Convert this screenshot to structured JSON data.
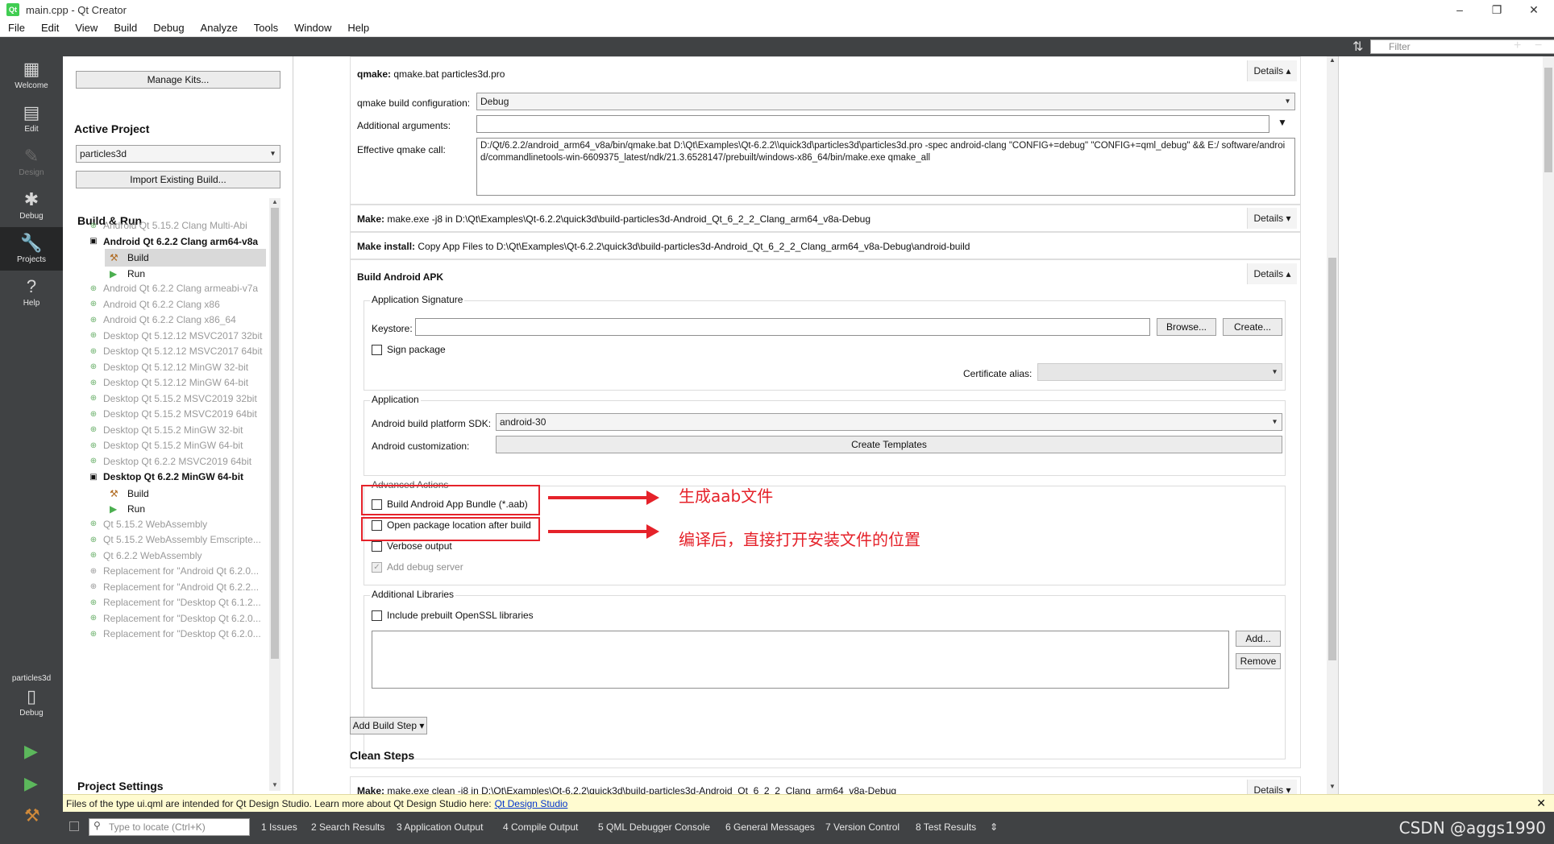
{
  "window": {
    "title": "main.cpp - Qt Creator",
    "logo_text": "Qt",
    "minimize": "–",
    "maximize": "❐",
    "close": "✕"
  },
  "menu": [
    "File",
    "Edit",
    "View",
    "Build",
    "Debug",
    "Analyze",
    "Tools",
    "Window",
    "Help"
  ],
  "modes": [
    {
      "label": "Welcome"
    },
    {
      "label": "Edit"
    },
    {
      "label": "Design"
    },
    {
      "label": "Debug"
    },
    {
      "label": "Projects"
    },
    {
      "label": "Help"
    }
  ],
  "kit_selector": {
    "project": "particles3d",
    "mode": "Debug"
  },
  "filter": {
    "placeholder": "Filter"
  },
  "left": {
    "manage_kits": "Manage Kits...",
    "active_project_heading": "Active Project",
    "active_project_value": "particles3d",
    "import_build": "Import Existing Build...",
    "build_run_heading": "Build & Run",
    "project_settings_heading": "Project Settings",
    "kits": [
      {
        "label": "Android Qt 5.15.2 Clang Multi-Abi",
        "style": "dim"
      },
      {
        "label": "Android Qt 6.2.2 Clang arm64-v8a",
        "style": "active"
      },
      {
        "label": "Android Qt 6.2.2 Clang armeabi-v7a",
        "style": "dim"
      },
      {
        "label": "Android Qt 6.2.2 Clang x86",
        "style": "dim"
      },
      {
        "label": "Android Qt 6.2.2 Clang x86_64",
        "style": "dim"
      },
      {
        "label": "Desktop Qt 5.12.12 MSVC2017 32bit",
        "style": "dim"
      },
      {
        "label": "Desktop Qt 5.12.12 MSVC2017 64bit",
        "style": "dim"
      },
      {
        "label": "Desktop Qt 5.12.12 MinGW 32-bit",
        "style": "dim"
      },
      {
        "label": "Desktop Qt 5.12.12 MinGW 64-bit",
        "style": "dim"
      },
      {
        "label": "Desktop Qt 5.15.2 MSVC2019 32bit",
        "style": "dim"
      },
      {
        "label": "Desktop Qt 5.15.2 MSVC2019 64bit",
        "style": "dim"
      },
      {
        "label": "Desktop Qt 5.15.2 MinGW 32-bit",
        "style": "dim"
      },
      {
        "label": "Desktop Qt 5.15.2 MinGW 64-bit",
        "style": "dim"
      },
      {
        "label": "Desktop Qt 6.2.2 MSVC2019 64bit",
        "style": "dim"
      },
      {
        "label": "Desktop Qt 6.2.2 MinGW 64-bit",
        "style": "active"
      },
      {
        "label": "Qt 5.15.2 WebAssembly",
        "style": "dim"
      },
      {
        "label": "Qt 5.15.2 WebAssembly Emscripte...",
        "style": "dim"
      },
      {
        "label": "Qt 6.2.2 WebAssembly",
        "style": "dim"
      },
      {
        "label": "Replacement for \"Android Qt 6.2.0...",
        "style": "repl"
      },
      {
        "label": "Replacement for \"Android Qt 6.2.2...",
        "style": "repl"
      },
      {
        "label": "Replacement for \"Desktop Qt 6.1.2...",
        "style": "dim"
      },
      {
        "label": "Replacement for \"Desktop Qt 6.2.0...",
        "style": "dim"
      },
      {
        "label": "Replacement for \"Desktop Qt 6.2.0...",
        "style": "dim"
      }
    ],
    "sub_build": "Build",
    "sub_run": "Run"
  },
  "main": {
    "qmake_label": "qmake:",
    "qmake_value": "qmake.bat particles3d.pro",
    "details": "Details",
    "qmake_build_config_label": "qmake build configuration:",
    "qmake_build_config_value": "Debug",
    "additional_args_label": "Additional arguments:",
    "effective_call_label": "Effective qmake call:",
    "effective_call_value": "D:/Qt/6.2.2/android_arm64_v8a/bin/qmake.bat D:\\Qt\\Examples\\Qt-6.2.2\\\\quick3d\\particles3d\\particles3d.pro -spec android-clang \"CONFIG+=debug\" \"CONFIG+=qml_debug\" && E:/ software/android/commandlinetools-win-6609375_latest/ndk/21.3.6528147/prebuilt/windows-x86_64/bin/make.exe qmake_all",
    "make_label": "Make:",
    "make_value": "make.exe -j8 in D:\\Qt\\Examples\\Qt-6.2.2\\quick3d\\build-particles3d-Android_Qt_6_2_2_Clang_arm64_v8a-Debug",
    "make_install_label": "Make install:",
    "make_install_value": "Copy App Files to D:\\Qt\\Examples\\Qt-6.2.2\\quick3d\\build-particles3d-Android_Qt_6_2_2_Clang_arm64_v8a-Debug\\android-build",
    "build_apk_title": "Build Android APK",
    "app_signature_title": "Application Signature",
    "keystore_label": "Keystore:",
    "browse": "Browse...",
    "create": "Create...",
    "sign_package": "Sign package",
    "cert_alias_label": "Certificate alias:",
    "application_title": "Application",
    "sdk_label": "Android build platform SDK:",
    "sdk_value": "android-30",
    "customization_label": "Android customization:",
    "create_templates": "Create Templates",
    "advanced_title": "Advanced Actions",
    "build_aab": "Build Android App Bundle (*.aab)",
    "open_pkg": "Open package location after build",
    "verbose": "Verbose output",
    "add_debug_server": "Add debug server",
    "add_libs_title": "Additional Libraries",
    "include_openssl": "Include prebuilt OpenSSL libraries",
    "add": "Add...",
    "remove": "Remove",
    "add_build_step": "Add Build Step",
    "clean_steps": "Clean Steps",
    "clean_make_label": "Make:",
    "clean_make_value": "make.exe clean -j8 in D:\\Qt\\Examples\\Qt-6.2.2\\quick3d\\build-particles3d-Android_Qt_6_2_2_Clang_arm64_v8a-Debug"
  },
  "annotations": {
    "aab": "生成aab文件",
    "open_pkg": "编译后，直接打开安装文件的位置",
    "color": "#e5222a"
  },
  "infobar": {
    "text": "Files of the type ui.qml are intended for Qt Design Studio. Learn more about Qt Design Studio here:",
    "link": "Qt Design Studio"
  },
  "statusbar": {
    "locate_placeholder": "Type to locate (Ctrl+K)",
    "panes": [
      "1  Issues",
      "2  Search Results",
      "3  Application Output",
      "4  Compile Output",
      "5  QML Debugger Console",
      "6  General Messages",
      "7  Version Control",
      "8  Test Results"
    ]
  },
  "watermark": "CSDN @aggs1990"
}
